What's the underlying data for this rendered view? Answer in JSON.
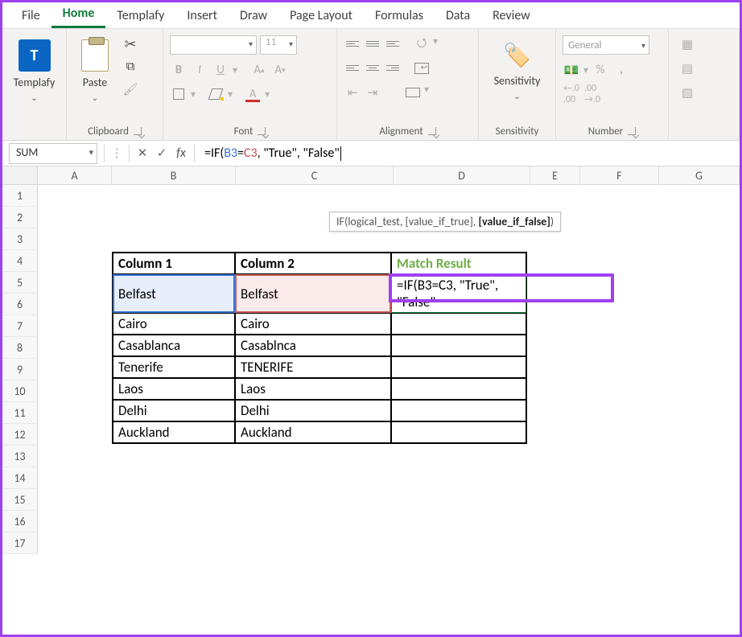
{
  "menu": {
    "items": [
      "File",
      "Home",
      "Templafy",
      "Insert",
      "Draw",
      "Page Layout",
      "Formulas",
      "Data",
      "Review"
    ],
    "active": "Home"
  },
  "ribbon": {
    "templafy": {
      "label": "Templafy"
    },
    "clipboard": {
      "paste": "Paste",
      "label": "Clipboard"
    },
    "font_group": {
      "name_placeholder": "",
      "size": "11",
      "bold": "B",
      "italic": "I",
      "underline": "U",
      "grow": "A",
      "shrink": "A",
      "color": "A",
      "label": "Font"
    },
    "alignment": {
      "label": "Alignment"
    },
    "sensitivity": {
      "button": "Sensitivity",
      "label": "Sensitivity"
    },
    "number": {
      "format": "General",
      "label": "Number",
      "percent": "%",
      "comma": ","
    }
  },
  "fxrow": {
    "namebox": "SUM",
    "fx": "fx",
    "formula_parts": {
      "eq": "=",
      "fn": "IF(",
      "ref1": "B3",
      "op": "=",
      "ref2": "C3",
      "rest": ", \"True\", \"False\""
    },
    "formula_plain": "=IF(B3=C3, \"True\", \"False\""
  },
  "tooltip": {
    "fn": "IF",
    "a1": "logical_test",
    "a2": "[value_if_true]",
    "a3": "[value_if_false]"
  },
  "grid": {
    "cols": [
      "A",
      "B",
      "C",
      "D",
      "E",
      "F",
      "G"
    ],
    "rows": [
      "1",
      "2",
      "3",
      "4",
      "5",
      "6",
      "7",
      "8",
      "9",
      "10",
      "11",
      "12",
      "13",
      "14",
      "15",
      "16",
      "17"
    ]
  },
  "table": {
    "headers": [
      "Column 1",
      "Column 2",
      "Match Result"
    ],
    "rows": [
      [
        "Belfast",
        "Belfast",
        "=IF(B3=C3, \"True\", \"False\""
      ],
      [
        "Cairo",
        "Cairo",
        ""
      ],
      [
        "Casablanca",
        "Casablnca",
        ""
      ],
      [
        "Tenerife",
        "TENERIFE",
        ""
      ],
      [
        "Laos",
        "Laos",
        ""
      ],
      [
        "Delhi",
        "Delhi",
        ""
      ],
      [
        "Auckland",
        "Auckland",
        ""
      ]
    ]
  },
  "chart_data": {
    "type": "table",
    "title": "",
    "columns": [
      "Column 1",
      "Column 2",
      "Match Result"
    ],
    "rows": [
      [
        "Belfast",
        "Belfast",
        "=IF(B3=C3, \"True\", \"False\""
      ],
      [
        "Cairo",
        "Cairo",
        ""
      ],
      [
        "Casablanca",
        "Casablnca",
        ""
      ],
      [
        "Tenerife",
        "TENERIFE",
        ""
      ],
      [
        "Laos",
        "Laos",
        ""
      ],
      [
        "Delhi",
        "Delhi",
        ""
      ],
      [
        "Auckland",
        "Auckland",
        ""
      ]
    ]
  },
  "colors": {
    "accent": "#0f7a3c",
    "highlight_purple": "#a040f0",
    "ref_blue": "#3573d6",
    "ref_red": "#c0504d",
    "header_green": "#70ad47"
  }
}
